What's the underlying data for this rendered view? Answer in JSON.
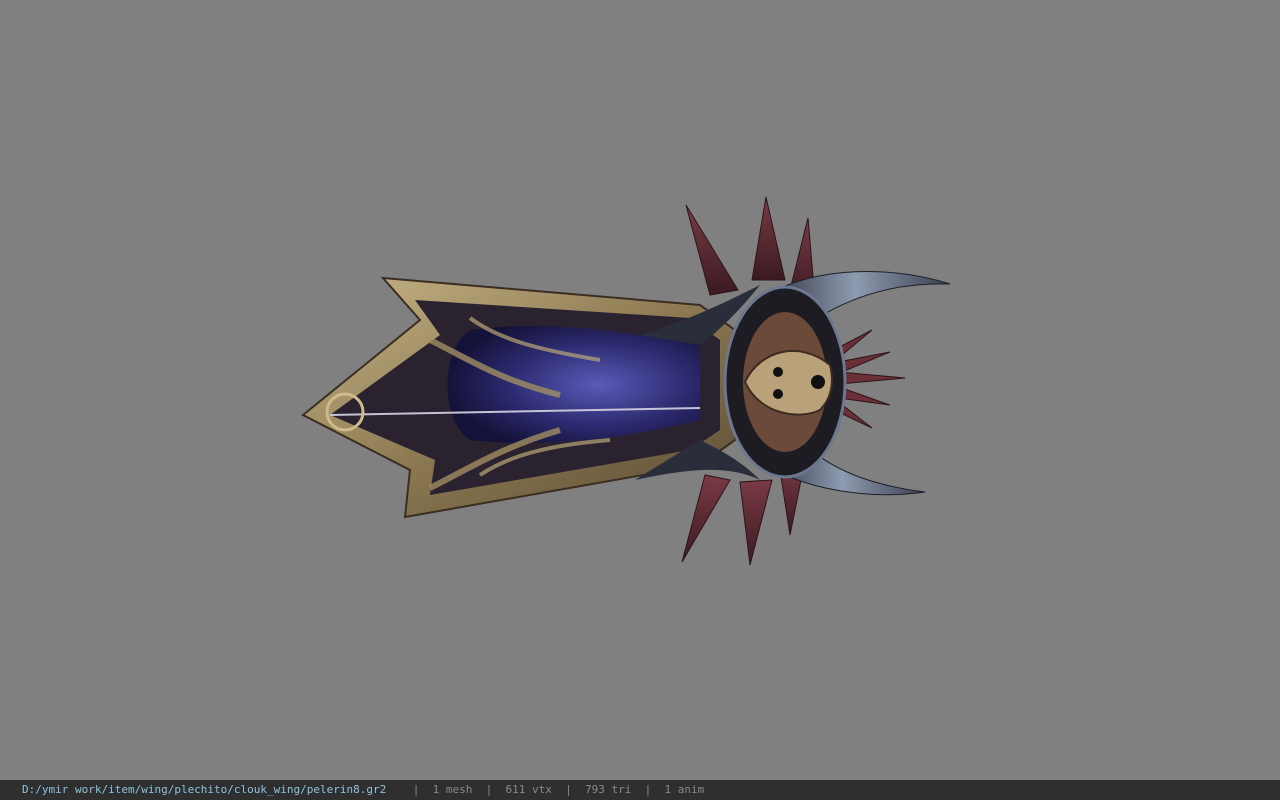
{
  "viewport": {
    "background_color": "#808080",
    "model": {
      "icon": "ornate-cloak-wing-model"
    }
  },
  "status_bar": {
    "file_path": "D:/ymir work/item/wing/plechito/clouk_wing/pelerin8.gr2",
    "separator": "|",
    "mesh_count": "1 mesh",
    "vertex_count": "611 vtx",
    "triangle_count": "793 tri",
    "anim_count": "1 anim",
    "path_color": "#8fc3dd",
    "text_color": "#8a8a8a"
  }
}
